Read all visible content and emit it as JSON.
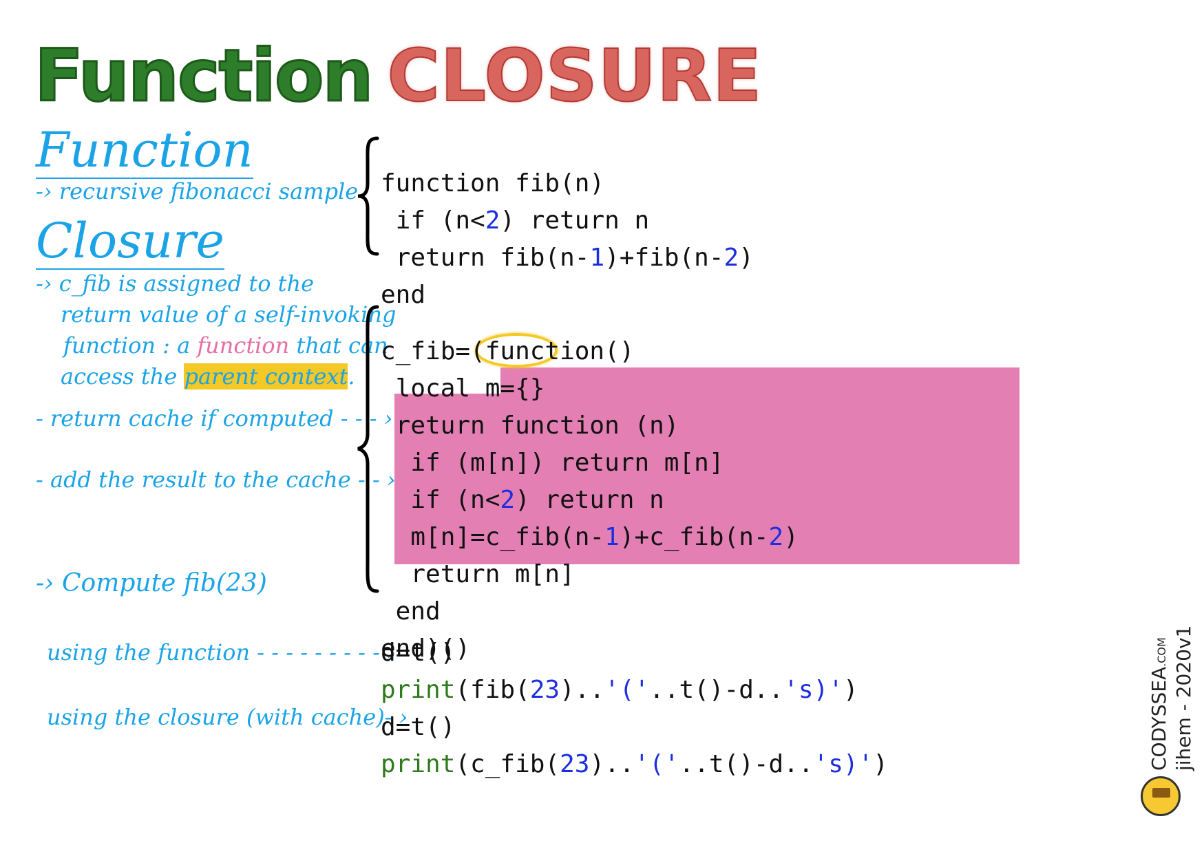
{
  "title": {
    "word1": "Function",
    "word2": "CLOSURE"
  },
  "left": {
    "function_heading": "Function",
    "function_note": "-› recursive fibonacci sample",
    "closure_heading": "Closure",
    "closure_note_1": "-› c_fib is assigned to the",
    "closure_note_2": "return value of a self-invoking",
    "closure_note_3a": "function : a ",
    "closure_note_3b": "function",
    "closure_note_3c": " that can",
    "closure_note_4a": "access the ",
    "closure_note_4b": "parent context",
    "closure_note_4c": ".",
    "cache_note": "- return cache if computed - - - ›",
    "add_note": "- add the result to the cache - - ›",
    "compute_note": "-› Compute fib(23)",
    "using_function": "using the function - - - - - - - - - ›",
    "using_closure": "using the closure (with cache)- ›"
  },
  "code": {
    "fib": [
      "function fib(n)",
      " if (n<2) return n",
      " return fib(n-1)+fib(n-2)",
      "end"
    ],
    "closure": [
      "c_fib=(function()",
      " local m={}",
      " return function (n)",
      "  if (m[n]) return m[n]",
      "  if (n<2) return n",
      "  m[n]=c_fib(n-1)+c_fib(n-2)",
      "  return m[n]",
      " end",
      "end)()"
    ],
    "run": [
      "d=t()",
      "print(fib(23)..'('..t()-d..'s)')",
      "d=t()",
      "print(c_fib(23)..'('..t()-d..'s)')"
    ]
  },
  "signature": {
    "brand": "CODYSSEA",
    "tld": ".COM",
    "author": "jihem - 2020v1"
  },
  "colors": {
    "title_green": "#2d7d2a",
    "title_red": "#d9655f",
    "note_blue": "#1aa3e6",
    "highlight_pink": "#e47fb4",
    "highlight_yellow": "#f4c825",
    "number_blue": "#1c2fe0",
    "print_green": "#2f7a1c"
  }
}
